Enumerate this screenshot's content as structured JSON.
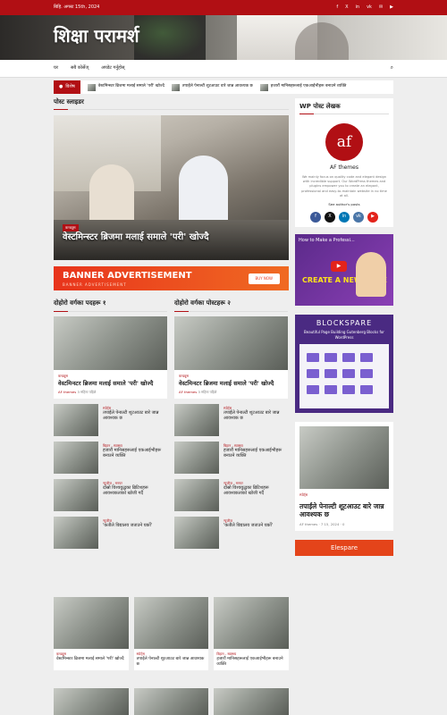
{
  "topbar": {
    "date": "बिहि. अगस्ट 15th, 2024",
    "social": [
      "f",
      "X",
      "in",
      "vk",
      "✉",
      "▶"
    ]
  },
  "site": {
    "title": "शिक्षा परामर्श"
  },
  "nav": {
    "items": [
      "घर",
      "सबै कोर्सेज्",
      "अपडेट गर्नुहोस्"
    ],
    "search": "⌕"
  },
  "ticker": {
    "label": "विशेष",
    "items": [
      "वेस्टमिन्स्टर ब्रिजमा मलाई समाले 'परी' खोज्दै",
      "तपाईंले पेनाल्टी शूटआउट वारे जान्न आवश्यक छ",
      "हजारौं मानिसहरूलाई एकआईभीहरू बनाउने व्यक्ति"
    ]
  },
  "main": {
    "slider_title": "पोस्ट स्लाइडर",
    "slider": {
      "category": "कन्ड्यूस",
      "caption": "वेस्टमिन्स्टर ब्रिजमा मलाई समाले 'परी' खोज्दै"
    },
    "banner": {
      "title": "BANNER ADVERTISEMENT",
      "sub": "BANNER ADVERTISEMENT",
      "button": "BUY NOW"
    },
    "col1": {
      "title": "दोहोरो वर्गका पदहरू १",
      "featured": {
        "category": "कन्ड्यूस",
        "title": "वेस्टमिन्स्टर ब्रिजमा मलाई समाले 'परी' खोज्दै",
        "author": "AF themes",
        "time": "3 महिना पहिले"
      },
      "list": [
        {
          "cat": "स्पोर्ट्स",
          "title": "तपाईंले पेनाल्टी शूटआउट बारे जान्न आवश्यक छ"
        },
        {
          "cat": "बिहान - स्वास्थ्य",
          "title": "हजारौं मानिसहरूलाई एकआईभीहरू बनाउने व्यक्ति"
        },
        {
          "cat": "न्यूजीज - मनपर",
          "title": "दोस्रो विश्वयुद्धका ब्रिटिशहरू आवश्यकताको खोजी गर्दै"
        },
        {
          "cat": "न्यूजीज",
          "title": "'कतीले विद्यालय जताउने घर्को'"
        }
      ]
    },
    "col2": {
      "title": "दोहोरो वर्गका पोस्टहरू २",
      "featured": {
        "category": "कन्ड्यूस",
        "title": "वेस्टमिन्स्टर ब्रिजमा मलाई समाले 'परी' खोज्दै",
        "author": "AF themes",
        "time": "3 महिना पहिले"
      },
      "list": [
        {
          "cat": "स्पोर्ट्स",
          "title": "तपाईंले पेनाल्टी शूटआउट बारे जान्न आवश्यक छ"
        },
        {
          "cat": "बिहान - स्वास्थ्य",
          "title": "हजारौं मानिसहरूलाई एकआईभीहरू बनाउने व्यक्ति"
        },
        {
          "cat": "न्यूजीज - मनपर",
          "title": "दोस्रो विश्वयुद्धका ब्रिटिशहरू आवश्यकताको खोजी गर्दै"
        },
        {
          "cat": "न्यूजीज",
          "title": "'कतीले विद्यालय जताउने घर्को'"
        }
      ]
    }
  },
  "bottom": [
    {
      "cat": "कन्ड्यूस",
      "title": "वेस्टमिन्स्टर ब्रिजमा मलाई समाले 'परी' खोज्दै"
    },
    {
      "cat": "स्पोर्ट्स",
      "title": "तपाईंले पेनाल्टी शूटआउट बारे जान्न आवश्यक छ"
    },
    {
      "cat": "बिहान - स्वास्थ्य",
      "title": "हजारौं मानिसहरूलाई एकआईभीहरू बनाउने व्यक्ति"
    }
  ],
  "sidebar": {
    "author_title": "WP पोस्ट लेखक",
    "author_initials": "af",
    "author_name": "AF themes",
    "author_desc": "We mainly focus on quality code and elegant design with incredible support. Our WordPress themes and plugins empower you to create an elegant, professional and easy-to-maintain website in no time at all.",
    "author_posts": "See author's posts",
    "video": {
      "title": "How to Make a Professi...",
      "headline": "CREATE A NEWS SITE"
    },
    "blockspare": {
      "title": "BLOCKSPARE",
      "sub": "Beautiful Page Building Gutenberg Blocks for WordPress"
    },
    "card": {
      "cat": "स्पोर्ट्स",
      "title": "तपाईंले पेनाल्टी शूटआउट बारे जान्न आवश्यक छ",
      "author": "AF themes",
      "date": "7 15, 2024",
      "comments": "0"
    },
    "elespare": "Elespare"
  }
}
